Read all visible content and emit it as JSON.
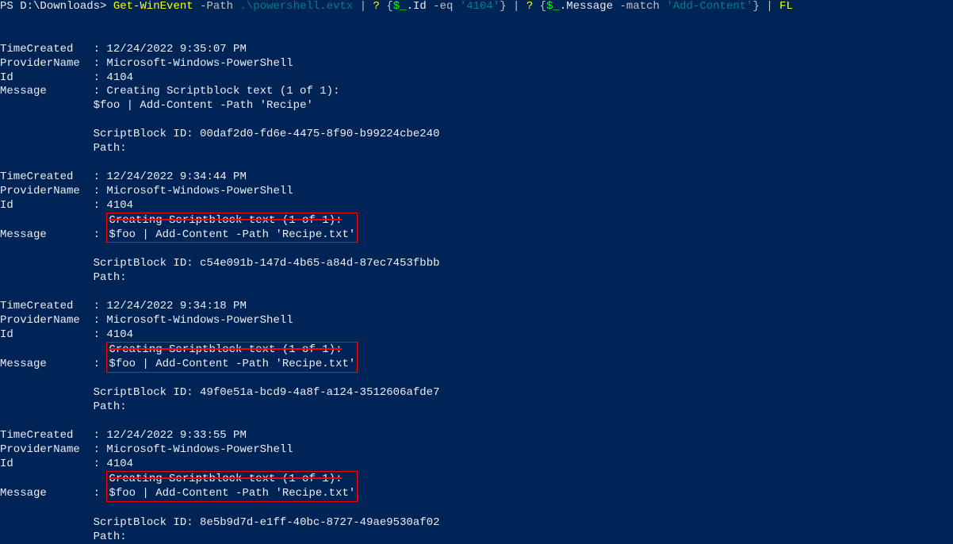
{
  "prompt": {
    "ps": "PS ",
    "cwd": "D:\\Downloads> ",
    "cmd": "Get-WinEvent",
    "param_path": " -Path",
    "path_val": " .\\powershell.evtx",
    "pipe1": " | ",
    "q1": "?",
    "brace_o1": " {",
    "var1": "$_",
    "prop1": ".Id",
    "op1": " -eq ",
    "str1": "'4104'",
    "brace_c1": "}",
    "pipe2": " | ",
    "q2": "?",
    "brace_o2": " {",
    "var2": "$_",
    "prop2": ".Message",
    "op2": " -match ",
    "str2": "'Add-Content'",
    "brace_c2": "}",
    "pipe3": " | ",
    "fl": "FL"
  },
  "labels": {
    "time": "TimeCreated",
    "prov": "ProviderName",
    "id": "Id",
    "msg": "Message",
    "sep": " : "
  },
  "common": {
    "provider": "Microsoft-Windows-PowerShell",
    "id": "4104",
    "msg_l1": "Creating Scriptblock text (1 of 1):",
    "path_label": "              Path:",
    "sb_label": "              ScriptBlock ID: ",
    "indent": "              "
  },
  "events": [
    {
      "time": "12/24/2022 9:35:07 PM",
      "foo": "$foo | Add-Content -Path 'Recipe'",
      "sbid": "00daf2d0-fd6e-4475-8f90-b99224cbe240",
      "hl": false
    },
    {
      "time": "12/24/2022 9:34:44 PM",
      "foo": "$foo | Add-Content -Path 'Recipe.txt'",
      "sbid": "c54e091b-147d-4b65-a84d-87ec7453fbbb",
      "hl": true
    },
    {
      "time": "12/24/2022 9:34:18 PM",
      "foo": "$foo | Add-Content -Path 'Recipe.txt'",
      "sbid": "49f0e51a-bcd9-4a8f-a124-3512606afde7",
      "hl": true
    },
    {
      "time": "12/24/2022 9:33:55 PM",
      "foo": "$foo | Add-Content -Path 'Recipe.txt'",
      "sbid": "8e5b9d7d-e1ff-40bc-8727-49ae9530af02",
      "hl": true
    }
  ]
}
